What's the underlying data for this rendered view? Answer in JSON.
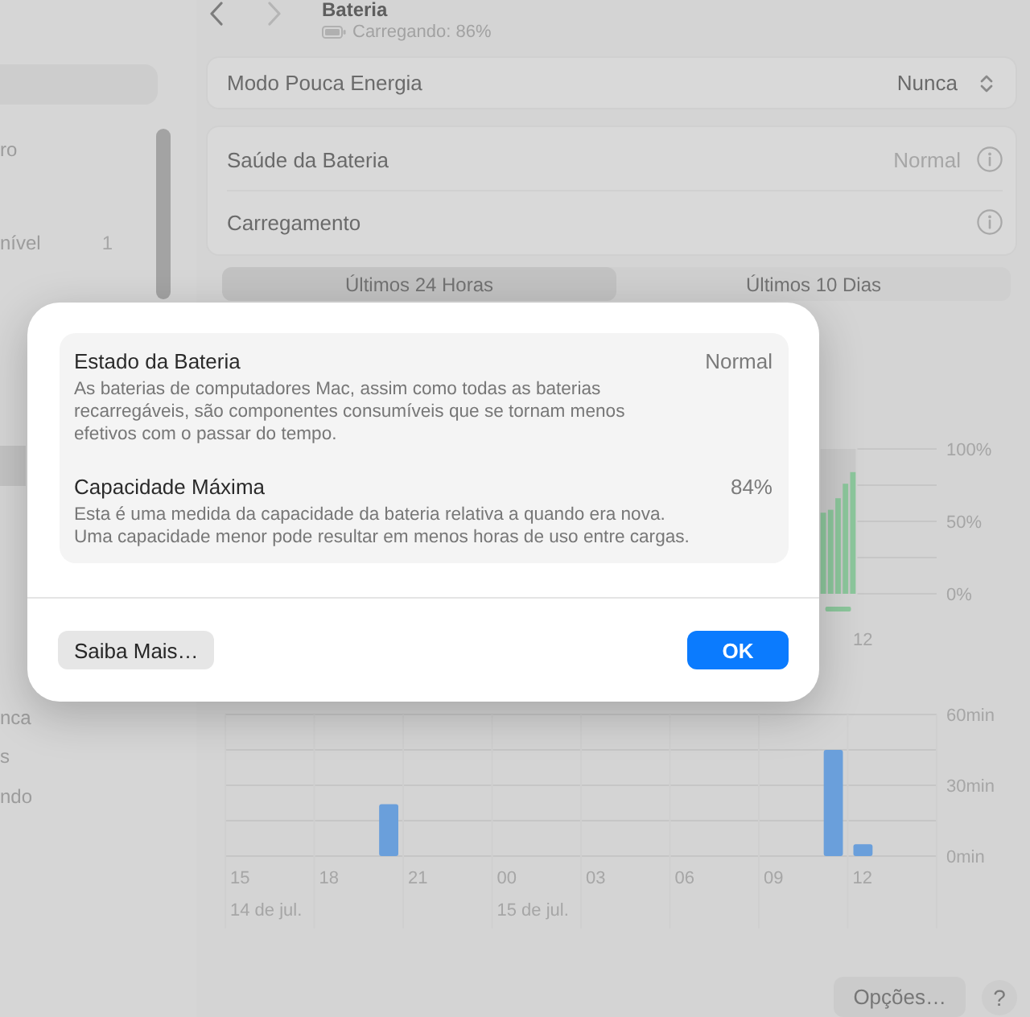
{
  "sidebar": {
    "items": [
      {
        "label": "ro",
        "selected": false
      },
      {
        "label": "nível",
        "badge": "1",
        "selected": false
      },
      {
        "selected": true
      },
      {
        "label": "nca",
        "selected": false
      },
      {
        "label": "s",
        "selected": false
      },
      {
        "label": "ndo",
        "selected": false
      }
    ]
  },
  "toolbar": {
    "nav_buttons": [
      {
        "kind": "back",
        "disabled": false
      },
      {
        "kind": "forward",
        "disabled": true
      }
    ],
    "title": "Bateria",
    "status": "Carregando: 86%"
  },
  "settings_groups": [
    [
      {
        "label": "Modo Pouca Energia",
        "value": "Nunca",
        "kind": "popup"
      }
    ],
    [
      {
        "label": "Saúde da Bateria",
        "value": "Normal",
        "kind": "info"
      },
      {
        "label": "Carregamento",
        "kind": "info"
      }
    ]
  ],
  "range_tabs": [
    {
      "label": "Últimos 24 Horas",
      "selected": true
    },
    {
      "label": "Últimos 10 Dias",
      "selected": false
    }
  ],
  "battery_chart": {
    "axis_labels": [
      "100%",
      "50%",
      "0%"
    ],
    "time_label": "12"
  },
  "screen_time_chart": {
    "chart_data": {
      "type": "bar",
      "categories": [
        "15",
        null,
        null,
        "18",
        null,
        null,
        "21",
        null,
        null,
        "00",
        null,
        null,
        "03",
        null,
        null,
        "06",
        null,
        null,
        "09",
        null,
        null,
        "12",
        null,
        null
      ],
      "values": [
        null,
        null,
        null,
        null,
        null,
        22,
        null,
        null,
        null,
        null,
        null,
        null,
        null,
        null,
        null,
        null,
        null,
        null,
        null,
        null,
        45,
        5,
        null,
        null
      ],
      "ylim": [
        0,
        60
      ],
      "yticks": [
        {
          "value": 0,
          "label": "0min"
        },
        {
          "value": 30,
          "label": "30min"
        },
        {
          "value": 60,
          "label": "60min"
        }
      ],
      "annotations": [
        "14 de jul.",
        "15 de jul."
      ]
    }
  },
  "footer": {
    "options_button": "Opções…",
    "help_button": "?"
  },
  "dialog": {
    "sections": [
      {
        "title": "Estado da Bateria",
        "value": "Normal",
        "description": "As baterias de computadores Mac, assim como todas as baterias recarregáveis, são componentes consumíveis que se tornam menos efetivos com o passar do tempo."
      },
      {
        "title": "Capacidade Máxima",
        "value": "84%",
        "description": "Esta é uma medida da capacidade da bateria relativa a quando era nova. Uma capacidade menor pode resultar em menos horas de uso entre cargas."
      }
    ],
    "buttons": [
      {
        "label": "Saiba Mais…",
        "kind": "secondary"
      },
      {
        "label": "OK",
        "kind": "default"
      }
    ]
  }
}
